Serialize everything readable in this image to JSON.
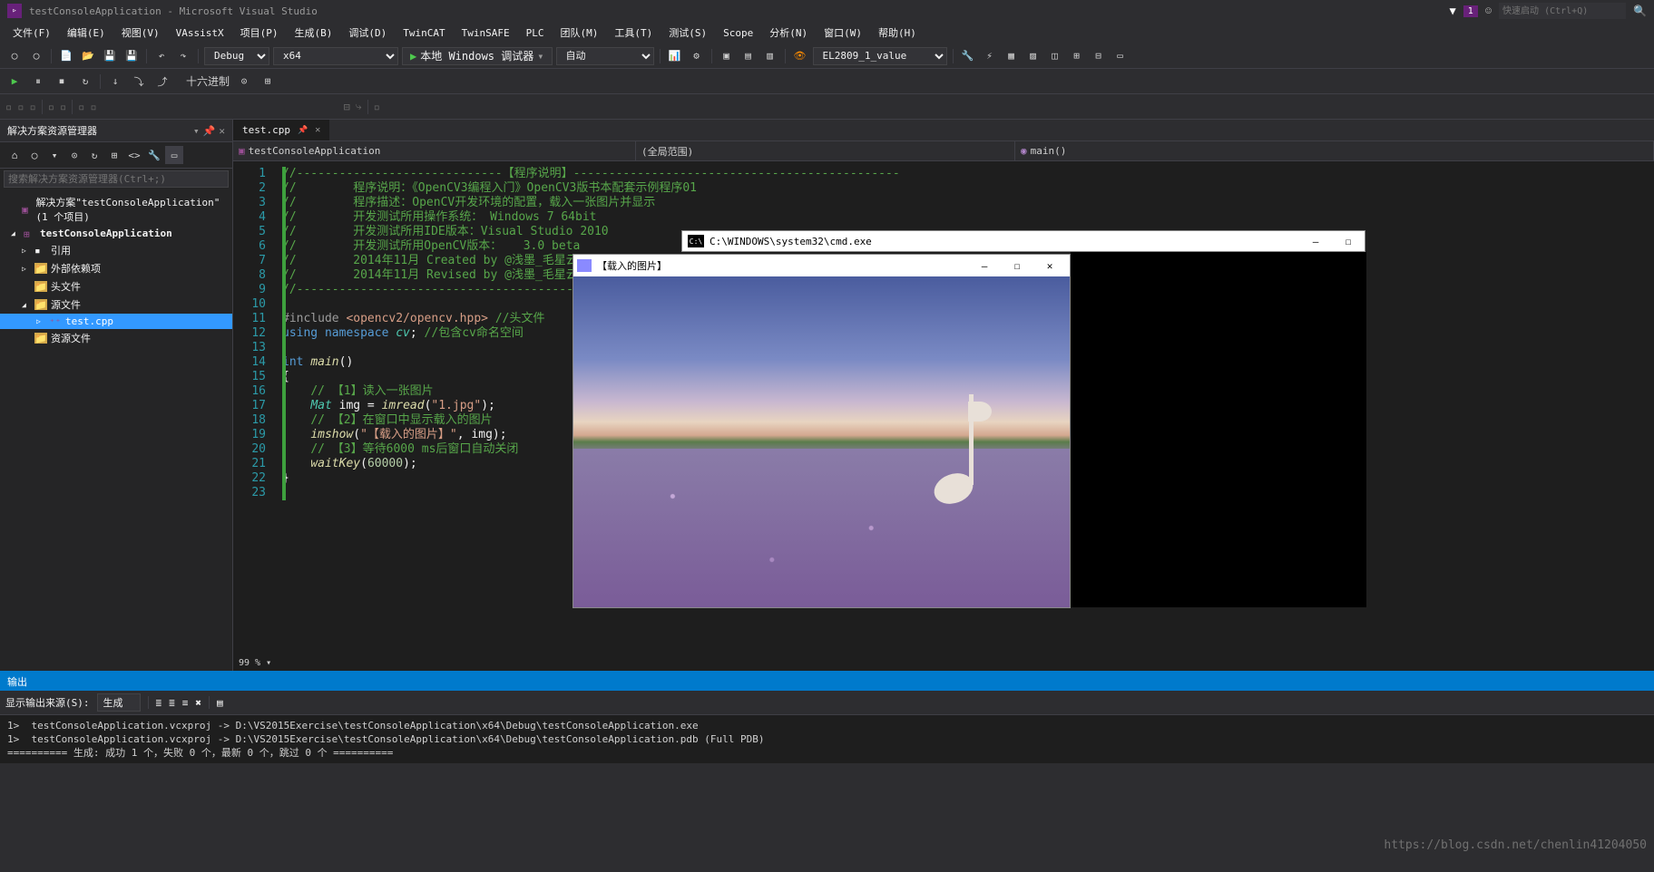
{
  "title": "testConsoleApplication - Microsoft Visual Studio",
  "quicklaunch_placeholder": "快速启动 (Ctrl+Q)",
  "flag_count": "1",
  "menu": [
    "文件(F)",
    "编辑(E)",
    "视图(V)",
    "VAssistX",
    "项目(P)",
    "生成(B)",
    "调试(D)",
    "TwinCAT",
    "TwinSAFE",
    "PLC",
    "团队(M)",
    "工具(T)",
    "测试(S)",
    "Scope",
    "分析(N)",
    "窗口(W)",
    "帮助(H)"
  ],
  "toolbar": {
    "config": "Debug",
    "platform": "x64",
    "debugger": "本地 Windows 调试器",
    "mode": "自动",
    "var": "EL2809_1_value"
  },
  "toolbar2": {
    "radix": "十六进制"
  },
  "solution_explorer": {
    "title": "解决方案资源管理器",
    "search_placeholder": "搜索解决方案资源管理器(Ctrl+;)",
    "sln": "解决方案\"testConsoleApplication\"(1 个项目)",
    "project": "testConsoleApplication",
    "refs": "引用",
    "ext": "外部依赖项",
    "headers": "头文件",
    "sources": "源文件",
    "file": "test.cpp",
    "resources": "资源文件"
  },
  "tab": {
    "name": "test.cpp"
  },
  "nav": {
    "scope1": "testConsoleApplication",
    "scope2": "(全局范围)",
    "scope3": "main()"
  },
  "code_lines": [
    "//-----------------------------【程序说明】----------------------------------------------",
    "//        程序说明：《OpenCV3编程入门》OpenCV3版书本配套示例程序01",
    "//        程序描述：OpenCV开发环境的配置，载入一张图片并显示",
    "//        开发测试所用操作系统： Windows 7 64bit",
    "//        开发测试所用IDE版本：Visual Studio 2010",
    "//        开发测试所用OpenCV版本：   3.0 beta",
    "//        2014年11月 Created by @浅墨_毛星云",
    "//        2014年11月 Revised by @浅墨_毛星云",
    "//----------------------------------------------------------------------------------------",
    "",
    "#include <opencv2/opencv.hpp> //头文件",
    "using namespace cv; //包含cv命名空间",
    "",
    "int main()",
    "{",
    "    // 【1】读入一张图片",
    "    Mat img = imread(\"1.jpg\");",
    "    // 【2】在窗口中显示载入的图片",
    "    imshow(\"【载入的图片】\", img);",
    "    // 【3】等待6000 ms后窗口自动关闭",
    "    waitKey(60000);",
    "}"
  ],
  "zoom": "99 %",
  "output": {
    "title": "输出",
    "source_label": "显示输出来源(S):",
    "source": "生成",
    "lines": [
      "1>  testConsoleApplication.vcxproj -> D:\\VS2015Exercise\\testConsoleApplication\\x64\\Debug\\testConsoleApplication.exe",
      "1>  testConsoleApplication.vcxproj -> D:\\VS2015Exercise\\testConsoleApplication\\x64\\Debug\\testConsoleApplication.pdb (Full PDB)",
      "========== 生成: 成功 1 个，失败 0 个，最新 0 个，跳过 0 个 =========="
    ]
  },
  "cmd": {
    "title": "C:\\WINDOWS\\system32\\cmd.exe"
  },
  "imgwin": {
    "title": "【载入的图片】"
  },
  "watermark": "https://blog.csdn.net/chenlin41204050"
}
